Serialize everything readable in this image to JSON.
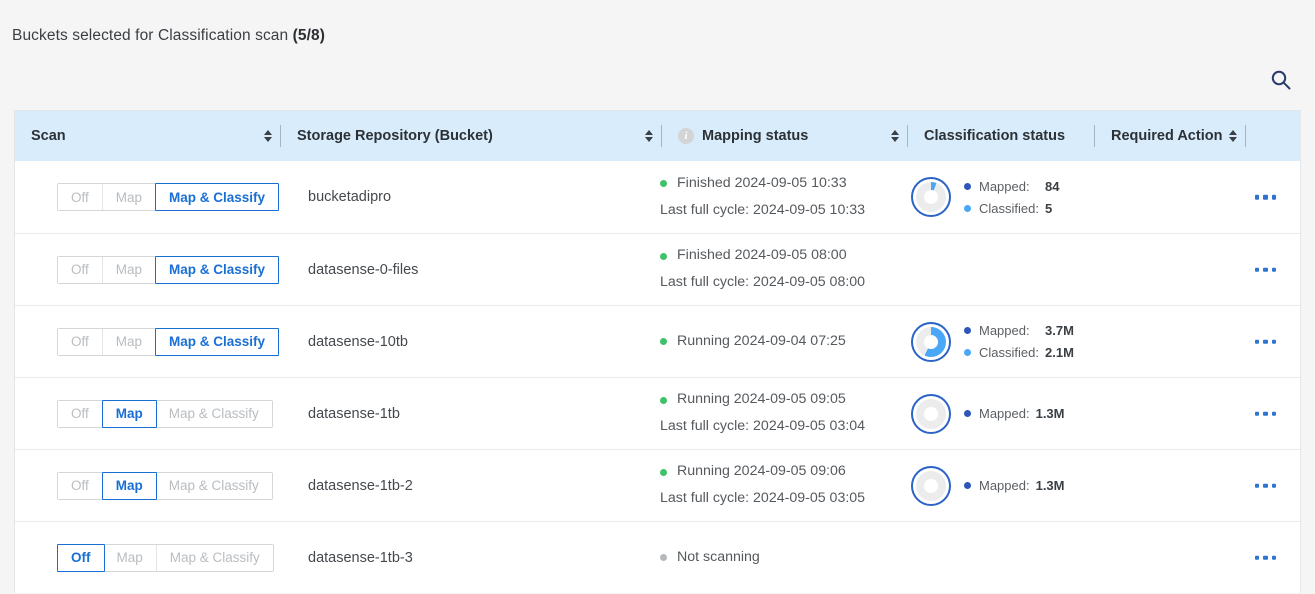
{
  "header": {
    "title_prefix": "Buckets selected for Classification scan",
    "title_count": "(5/8)",
    "search_icon": "search-icon"
  },
  "table": {
    "columns": [
      {
        "key": "scan",
        "label": "Scan",
        "sortable": true,
        "info": false
      },
      {
        "key": "bucket",
        "label": "Storage Repository (Bucket)",
        "sortable": true,
        "info": false
      },
      {
        "key": "map",
        "label": "Mapping status",
        "sortable": true,
        "info": true,
        "info_icon": "info-icon"
      },
      {
        "key": "class",
        "label": "Classification status",
        "sortable": false,
        "info": false
      },
      {
        "key": "action",
        "label": "Required Action",
        "sortable": true,
        "info": false
      }
    ],
    "scan_options": [
      "Off",
      "Map",
      "Map & Classify"
    ],
    "legend_labels": {
      "mapped": "Mapped:",
      "classified": "Classified:"
    },
    "cycle_prefix": "Last full cycle:",
    "row_menu_icon": "kebab-menu-icon",
    "rows": [
      {
        "scan_selected": "Map & Classify",
        "bucket": "bucketadipro",
        "status_text": "Finished 2024-09-05 10:33",
        "status_state": "green",
        "cycle_text": "Last full cycle: 2024-09-05 10:33",
        "donut": true,
        "donut_percent": 6,
        "mapped": "84",
        "classified": "5"
      },
      {
        "scan_selected": "Map & Classify",
        "bucket": "datasense-0-files",
        "status_text": "Finished 2024-09-05 08:00",
        "status_state": "green",
        "cycle_text": "Last full cycle: 2024-09-05 08:00",
        "donut": false,
        "donut_percent": 0,
        "mapped": "",
        "classified": ""
      },
      {
        "scan_selected": "Map & Classify",
        "bucket": "datasense-10tb",
        "status_text": "Running 2024-09-04 07:25",
        "status_state": "green",
        "cycle_text": "",
        "donut": true,
        "donut_percent": 57,
        "mapped": "3.7M",
        "classified": "2.1M"
      },
      {
        "scan_selected": "Map",
        "bucket": "datasense-1tb",
        "status_text": "Running 2024-09-05 09:05",
        "status_state": "green",
        "cycle_text": "Last full cycle: 2024-09-05 03:04",
        "donut": true,
        "donut_percent": 0,
        "mapped": "1.3M",
        "classified": ""
      },
      {
        "scan_selected": "Map",
        "bucket": "datasense-1tb-2",
        "status_text": "Running 2024-09-05 09:06",
        "status_state": "green",
        "cycle_text": "Last full cycle: 2024-09-05 03:05",
        "donut": true,
        "donut_percent": 0,
        "mapped": "1.3M",
        "classified": ""
      },
      {
        "scan_selected": "Off",
        "bucket": "datasense-1tb-3",
        "status_text": "Not scanning",
        "status_state": "grey",
        "cycle_text": "",
        "donut": false,
        "donut_percent": 0,
        "mapped": "",
        "classified": ""
      }
    ]
  },
  "colors": {
    "header_bg": "#d9ecfb",
    "accent_blue": "#1a6fd4",
    "donut_ring": "#2b63c6",
    "donut_fill": "#49a7f5",
    "status_green": "#3ec16b",
    "status_grey": "#b5b9bc",
    "page_bg": "#f5f5f5"
  }
}
